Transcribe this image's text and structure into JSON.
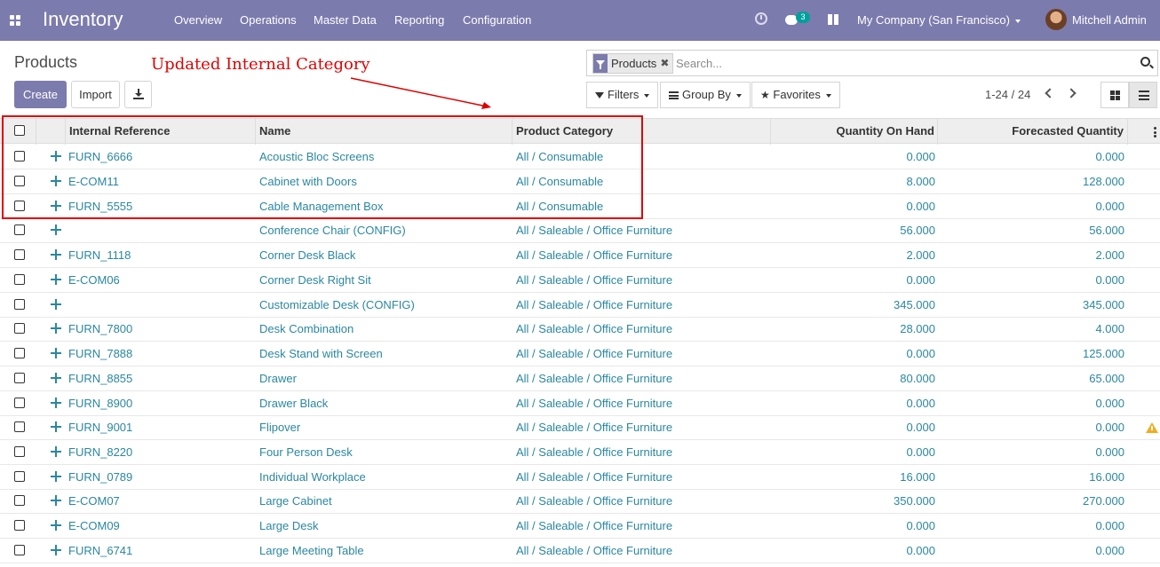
{
  "navbar": {
    "brand": "Inventory",
    "menu": [
      "Overview",
      "Operations",
      "Master Data",
      "Reporting",
      "Configuration"
    ],
    "chat_count": "3",
    "company": "My Company (San Francisco)",
    "user": "Mitchell Admin"
  },
  "control": {
    "breadcrumb": "Products",
    "annotation": "Updated Internal Category",
    "create_label": "Create",
    "import_label": "Import",
    "search_facet": "Products",
    "search_placeholder": "Search...",
    "filters_label": "Filters",
    "groupby_label": "Group By",
    "favorites_label": "Favorites",
    "pager": "1-24 / 24"
  },
  "table": {
    "columns": [
      "Internal Reference",
      "Name",
      "Product Category",
      "Quantity On Hand",
      "Forecasted Quantity"
    ],
    "rows": [
      {
        "ref": "FURN_6666",
        "name": "Acoustic Bloc Screens",
        "category": "All / Consumable",
        "on_hand": "0.000",
        "forecast": "0.000"
      },
      {
        "ref": "E-COM11",
        "name": "Cabinet with Doors",
        "category": "All / Consumable",
        "on_hand": "8.000",
        "forecast": "128.000"
      },
      {
        "ref": "FURN_5555",
        "name": "Cable Management Box",
        "category": "All / Consumable",
        "on_hand": "0.000",
        "forecast": "0.000"
      },
      {
        "ref": "",
        "name": "Conference Chair (CONFIG)",
        "category": "All / Saleable / Office Furniture",
        "on_hand": "56.000",
        "forecast": "56.000"
      },
      {
        "ref": "FURN_1118",
        "name": "Corner Desk Black",
        "category": "All / Saleable / Office Furniture",
        "on_hand": "2.000",
        "forecast": "2.000"
      },
      {
        "ref": "E-COM06",
        "name": "Corner Desk Right Sit",
        "category": "All / Saleable / Office Furniture",
        "on_hand": "0.000",
        "forecast": "0.000"
      },
      {
        "ref": "",
        "name": "Customizable Desk (CONFIG)",
        "category": "All / Saleable / Office Furniture",
        "on_hand": "345.000",
        "forecast": "345.000"
      },
      {
        "ref": "FURN_7800",
        "name": "Desk Combination",
        "category": "All / Saleable / Office Furniture",
        "on_hand": "28.000",
        "forecast": "4.000"
      },
      {
        "ref": "FURN_7888",
        "name": "Desk Stand with Screen",
        "category": "All / Saleable / Office Furniture",
        "on_hand": "0.000",
        "forecast": "125.000"
      },
      {
        "ref": "FURN_8855",
        "name": "Drawer",
        "category": "All / Saleable / Office Furniture",
        "on_hand": "80.000",
        "forecast": "65.000"
      },
      {
        "ref": "FURN_8900",
        "name": "Drawer Black",
        "category": "All / Saleable / Office Furniture",
        "on_hand": "0.000",
        "forecast": "0.000"
      },
      {
        "ref": "FURN_9001",
        "name": "Flipover",
        "category": "All / Saleable / Office Furniture",
        "on_hand": "0.000",
        "forecast": "0.000",
        "warning": true
      },
      {
        "ref": "FURN_8220",
        "name": "Four Person Desk",
        "category": "All / Saleable / Office Furniture",
        "on_hand": "0.000",
        "forecast": "0.000"
      },
      {
        "ref": "FURN_0789",
        "name": "Individual Workplace",
        "category": "All / Saleable / Office Furniture",
        "on_hand": "16.000",
        "forecast": "16.000"
      },
      {
        "ref": "E-COM07",
        "name": "Large Cabinet",
        "category": "All / Saleable / Office Furniture",
        "on_hand": "350.000",
        "forecast": "270.000"
      },
      {
        "ref": "E-COM09",
        "name": "Large Desk",
        "category": "All / Saleable / Office Furniture",
        "on_hand": "0.000",
        "forecast": "0.000"
      },
      {
        "ref": "FURN_6741",
        "name": "Large Meeting Table",
        "category": "All / Saleable / Office Furniture",
        "on_hand": "0.000",
        "forecast": "0.000"
      }
    ]
  },
  "colors": {
    "brand": "#7c7bad",
    "link": "#2a87a0",
    "annotation": "#e00000"
  }
}
